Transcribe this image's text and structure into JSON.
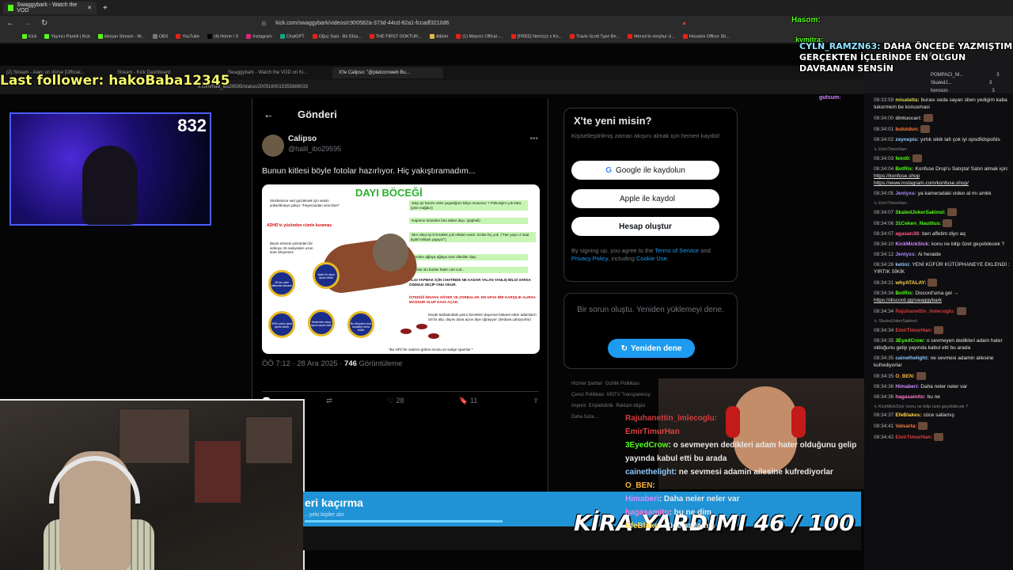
{
  "browser": {
    "tab_title": "Swaggybark - Watch the VOD",
    "url": "kick.com/swaggybark/videos/c900582a-373d-44cd-82a1-fccadf3210d6",
    "bookmarks": [
      "Kick",
      "Yayıncı Paneli | Kick",
      "ikinsan Stream - W...",
      "OBS",
      "YouTube",
      "(4) Home / X",
      "Instagram",
      "ChatGPT",
      "Oğuz Sasi - Bir Efsa...",
      "THE FIRST GOKTUR...",
      "Albüm",
      "(1) Meprez Offical -...",
      "[FREE] Nemzzz x Kn...",
      "Travis Scott Type Be...",
      "Mersin'in meşhur ci...",
      "Houston Officer Sh..."
    ],
    "all_bookmarks": "All Bookmarks"
  },
  "inner_browser": {
    "tabs": [
      "(2) Stream - Aiarc on dürse [Official...",
      "Stream - Kick Dashboard",
      "Swaggybark - Watch the VOD on Ki...",
      "X'te Calipso: \"@platcornweb Bu..."
    ],
    "url": "x.com/halil_ibo29595/status/2005160015355888033"
  },
  "overlays": {
    "last_follower": "Last follower: hakoBaba12345",
    "viewer_count": "832",
    "top_right_names": [
      "Hasom:",
      "kymitra:"
    ],
    "chat_replay": "Chat Replay",
    "big_message_user": "CYLN_RAMZN63:",
    "big_message": "DAHA ÖNCEDE YAZMIŞTIM GERÇEKTEN İÇLERİNDE EN OLGUN DAVRANAN SENSİN",
    "side_users": [
      {
        "name": "POMPACI_NI...",
        "count": "3"
      },
      {
        "name": "SkaledJ...",
        "count": "3"
      },
      {
        "name": "heroson",
        "count": "3"
      }
    ],
    "gutsum": "gutsum:",
    "kaginwali": "Kaginwali:"
  },
  "post": {
    "header": "Gönderi",
    "name": "Calipso",
    "handle": "@halil_ibo29595",
    "text": "Bunun kitlesi böyle fotolar hazırlıyor. Hiç yakıştıramadım...",
    "meme_title": "DAYI BÖCEĞİ",
    "meme_texts": {
      "t1": "Sinirlenince sert gözükmek için sesini yükseltmeye çalışır. *heyecandan sesi titrer*",
      "t2": "ADHD'si yüzünden cümle kuramaz.",
      "t3": "Beyin erimesi yüzünden bir videoyu 15 saniyeden uzun süre izleyemez",
      "t4": "-Dayı şir benim neler yaşadığımı biliyo musunuz ? Psikolojim çok kötü. (yine mağdur)",
      "t5": "-Kapımın önünden foto attılar dayı. (şüpheli)",
      "t6": "-Mor siteyi iyi ki bıraktık çok reklam vardı. Kickte hiç yok. (\"Her yayın 2 saat tiyatrl reklam yapıyor\")",
      "t7": "-Benden ağlaya ağlaya özür dilediler dayı.",
      "t8": "-Şunlar olu bunlar hater cart curt...",
      "t9": "ALGI YAPMAK İÇİN CHATİNDE NE KADAR YALAN YANLIŞ BİLGİ VARSA ÖZENLE SEÇİP ONU OKUR.",
      "t10": "İSTEDİĞİ İNSANA SÖVER VE ZORBALAR. EN UFAK BİR KARŞILIK ALIRSA MAĞDUR OLUP DAVA AÇAR.",
      "t11": "Küçük tarikatındaki yavru böcekleri dayısına hakaret eden adamların SS'ini alıp, dayısı dava açsın diye uğraşıyor. (bedava çalışıyorlar)",
      "t12": "*Bu NPC'ler sadece gülme emotu ve sadge spamlar *"
    },
    "medals": [
      "25 bin adet kitlesinin tamamı",
      "Ayda bir dava açma ödülü",
      "200'e yakın dava açma ödülü",
      "Kimlerden dava açma sayısı dolu",
      "Bu dünyanın ana karakteri olma ödülü"
    ],
    "meta_time": "ÖÖ 7:12 · 28 Ara 2025 · ",
    "views_num": "746",
    "views_label": " Görüntüleme",
    "likes": "28",
    "bookmarks": "11"
  },
  "x_side": {
    "title": "X'te yeni misin?",
    "subtitle": "Kişiselleştirilmiş zaman akışını almak için hemen kaydol!",
    "google": "Google ile kaydolun",
    "apple": "Apple ile kaydol",
    "create": "Hesap oluştur",
    "terms_pre": "By signing up, you agree to the ",
    "terms_link1": "Terms of Service",
    "terms_mid": " and ",
    "terms_link2": "Privacy Policy",
    "terms_mid2": ", including ",
    "terms_link3": "Cookie Use",
    "terms_end": ".",
    "error": "Bir sorun oluştu. Yeniden yüklemeyi dene.",
    "retry": "Yeniden dene",
    "footer": [
      "Hizmet Şartları",
      "Gizlilik Politikası",
      "Çerez Politikası",
      "MSTV Transparency",
      "Imprint",
      "Erişilebilirlik",
      "Reklam bilgisi",
      "Daha fazla ..."
    ]
  },
  "cam_chat": [
    {
      "u": "Rajuhanettin_lmlecoglu:",
      "t": "",
      "c": "#d23c3c"
    },
    {
      "u": "EmirTimurHan",
      "t": "",
      "c": "#e04040"
    },
    {
      "u": "3EyedCrow",
      "t": ": o sevmeyen dedikleri adam hater olduğunu gelip yayında kabul etti bu arada",
      "c": "#53fc18"
    },
    {
      "u": "cainethelight",
      "t": ": ne sevmesi adamin ailesine kufrediyorlar",
      "c": "#8fc8ff"
    },
    {
      "u": "O_BEN",
      "t": ":",
      "c": "#ffb340"
    },
    {
      "u": "Himaberi",
      "t": ": Daha neler neler var",
      "c": "#d28bff"
    },
    {
      "u": "hagasamito",
      "t": ": bu ne dim",
      "c": "#ff7ad0"
    },
    {
      "u": "EfeBlake",
      "t": ": cüce sallamış",
      "c": "#ffd24a"
    }
  ],
  "banner": {
    "label": "eri kaçırma",
    "sub": "...yeki kişiler alır",
    "kira": "KİRA YARDIMI 46 / 100"
  },
  "chat": [
    {
      "ts": "08:33:59",
      "u": "misalatta:",
      "c": "#d5d553",
      "t": "burası seda sayan sben yedigim kaba tukurmem be konusmasi"
    },
    {
      "ts": "08:34:00",
      "u": "dintuccari:",
      "c": "#b9b9b9",
      "t": ""
    },
    {
      "ts": "08:34:01",
      "u": "bulutdun:",
      "c": "#ff7a3c",
      "t": ""
    },
    {
      "ts": "08:34:02",
      "u": "zeynepis:",
      "c": "#8fc8ff",
      "t": "yırtık sikik lafı çok iyi opsdfidspofds"
    },
    {
      "reply": "EmirTimurHan:"
    },
    {
      "ts": "08:34:03",
      "u": "feint0:",
      "c": "#53fc18",
      "t": ""
    },
    {
      "ts": "08:34:04",
      "u": "BotRix:",
      "c": "#53fc18",
      "t": "Konfuse Drop'u Satışta! Satın almak için: ",
      "link": "https://konfuse.shop https://www.instagram.com/konfuse.shop/"
    },
    {
      "ts": "08:34:05",
      "u": "Jentyxs:",
      "c": "#a98bff",
      "t": "ya kameradaki video al mı amkk"
    },
    {
      "reply": "EmirTimurHan:"
    },
    {
      "ts": "08:34:07",
      "u": "SkaledJokerSakinol:",
      "c": "#53fc18",
      "t": ""
    },
    {
      "ts": "08:34:06",
      "u": "31Ceken_Nautilus:",
      "c": "#53fc18",
      "t": ""
    },
    {
      "ts": "08:34:07",
      "u": "agasan38:",
      "c": "#ff5a8a",
      "t": "ben affetim diyo aq"
    },
    {
      "ts": "08:34:10",
      "u": "KickMickSick:",
      "c": "#d28bff",
      "t": "konu ne bilip özet geçebilecek ?"
    },
    {
      "ts": "08:34:12",
      "u": "Jentyxs:",
      "c": "#a98bff",
      "t": "Ai heraide"
    },
    {
      "ts": "08:34:26",
      "u": "ketini:",
      "c": "#8fc8ff",
      "t": "YENİ KÜFÜR KÜTÜPHANEYE EKLENDİ : YIRTIK SİKİK"
    },
    {
      "ts": "08:34:31",
      "u": "whyATALAY:",
      "c": "#ffd24a",
      "t": ""
    },
    {
      "ts": "08:34:34",
      "u": "BotRix:",
      "c": "#53fc18",
      "t": "Discord'uma gel → ",
      "link": "https://discord.gg/swaggybark"
    },
    {
      "ts": "08:34:34",
      "u": "Rajuhanettin_lmlecoglu:",
      "c": "#d23c3c",
      "t": ""
    },
    {
      "reply": "SkaledJokerSakinol:"
    },
    {
      "ts": "08:34:34",
      "u": "EmirTimurHan:",
      "c": "#e04040",
      "t": ""
    },
    {
      "ts": "08:34:35",
      "u": "3EyedCrow:",
      "c": "#53fc18",
      "t": "o sevmeyen dedikleri adam hater olduğunu gelip yayında kabul etti bu arada"
    },
    {
      "ts": "08:34:35",
      "u": "cainethelight:",
      "c": "#8fc8ff",
      "t": "ne sevmesi adamin ailesine kufrediyorlar"
    },
    {
      "ts": "08:34:35",
      "u": "O_BEN:",
      "c": "#ffb340",
      "t": ""
    },
    {
      "ts": "08:34:36",
      "u": "Himaberi:",
      "c": "#d28bff",
      "t": "Daha neler neler var"
    },
    {
      "ts": "08:34:36",
      "u": "hagasamito:",
      "c": "#ff7ad0",
      "t": "bu ne"
    },
    {
      "reply": "KickMickSick: konu ne bilip özet geçebilecek ?"
    },
    {
      "ts": "08:34:37",
      "u": "EfeBlakes:",
      "c": "#ffd24a",
      "t": "cüce sallamış"
    },
    {
      "ts": "08:34:41",
      "u": "Valsarta:",
      "c": "#ff7a3c",
      "t": ""
    },
    {
      "ts": "08:34:42",
      "u": "EmirTimurHan:",
      "c": "#e04040",
      "t": ""
    }
  ],
  "colors": {
    "kick_green": "#53fc18",
    "x_blue": "#1d9bf0",
    "banner_blue": "#1f93d6",
    "follower_yellow": "#f5f56a"
  }
}
